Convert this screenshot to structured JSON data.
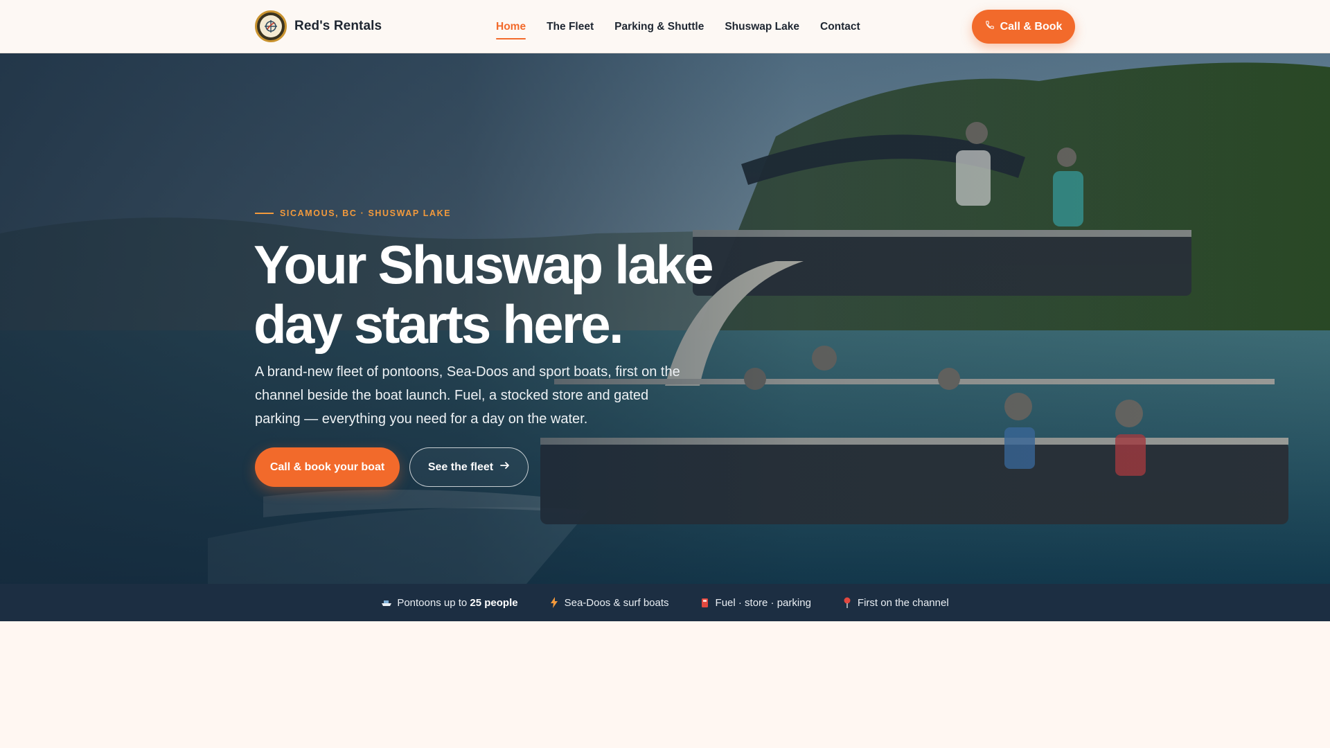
{
  "header": {
    "brand_name": "Red's Rentals",
    "logo_icon": "ship-wheel-logo",
    "nav": [
      {
        "label": "Home",
        "active": true
      },
      {
        "label": "The Fleet",
        "active": false
      },
      {
        "label": "Parking & Shuttle",
        "active": false
      },
      {
        "label": "Shuswap Lake",
        "active": false
      },
      {
        "label": "Contact",
        "active": false
      }
    ],
    "cta": {
      "label": "Call & Book",
      "icon": "phone-icon"
    }
  },
  "hero": {
    "eyebrow": "SICAMOUS, BC · SHUSWAP LAKE",
    "headline": "Your Shuswap lake day starts here.",
    "subtext": "A brand-new fleet of pontoons, Sea-Doos and sport boats, first on the channel beside the boat launch. Fuel, a stocked store and gated parking — everything you need for a day on the water.",
    "primary_button": "Call & book your boat",
    "secondary_button": "See the fleet",
    "secondary_icon": "arrow-right-icon",
    "image_alt": "Family on a double-decker pontoon boat on a forested lake"
  },
  "features": [
    {
      "icon": "boat-icon",
      "text": "Pontoons up to ",
      "bold": "25 people"
    },
    {
      "icon": "lightning-icon",
      "text": "Sea-Doos & surf boats",
      "bold": ""
    },
    {
      "icon": "fuel-icon",
      "text": "Fuel · store · parking",
      "bold": ""
    },
    {
      "icon": "pin-icon",
      "text": "First on the channel",
      "bold": ""
    }
  ],
  "colors": {
    "accent": "#f26a2b",
    "eyebrow": "#f39a3c",
    "strip": "#1c2e42",
    "page_bg": "#fff7f2"
  }
}
